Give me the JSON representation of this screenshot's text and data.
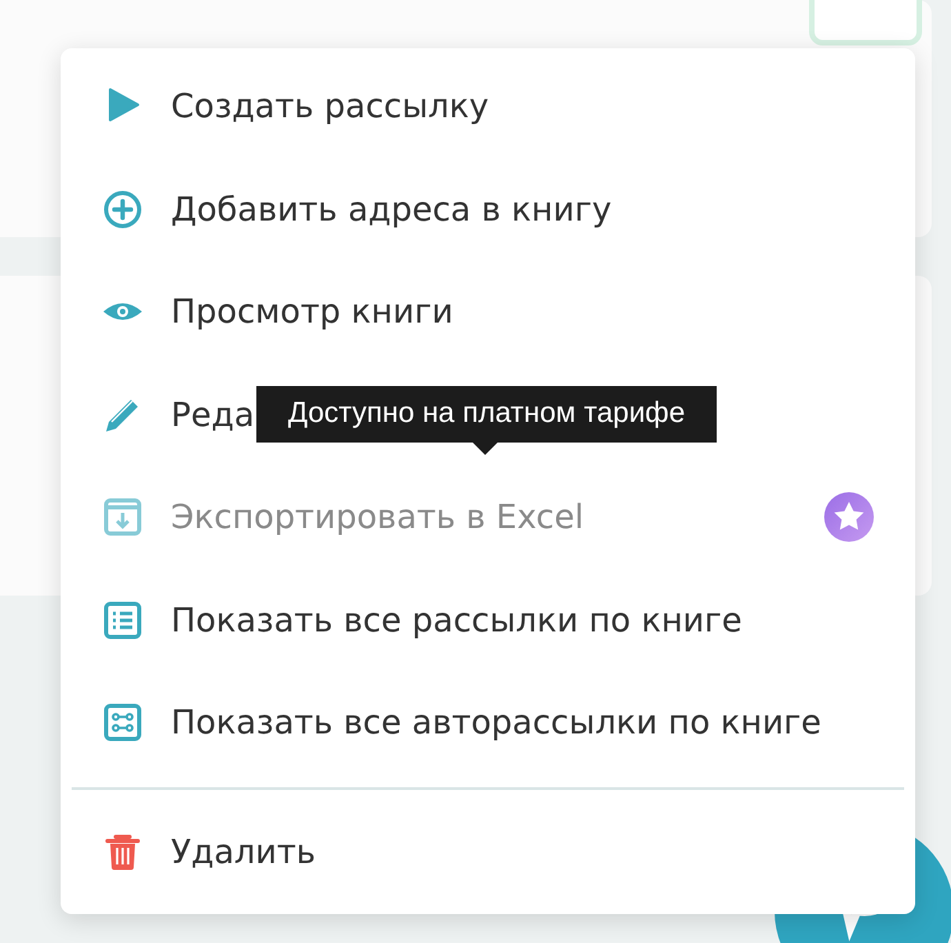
{
  "menu": {
    "items": [
      {
        "label": "Создать рассылку",
        "kind": "action",
        "disabled": false,
        "premium": false
      },
      {
        "label": "Добавить адреса в книгу",
        "kind": "action",
        "disabled": false,
        "premium": false
      },
      {
        "label": "Просмотр книги",
        "kind": "action",
        "disabled": false,
        "premium": false
      },
      {
        "label": "Реда",
        "kind": "action",
        "disabled": false,
        "premium": false
      },
      {
        "label": "Экспортировать в Excel",
        "kind": "action",
        "disabled": true,
        "premium": true
      },
      {
        "label": "Показать все рассылки по книге",
        "kind": "action",
        "disabled": false,
        "premium": false
      },
      {
        "label": "Показать все авторассылки по книге",
        "kind": "action",
        "disabled": false,
        "premium": false
      },
      {
        "label": "Удалить",
        "kind": "danger",
        "disabled": false,
        "premium": false
      }
    ]
  },
  "tooltip": {
    "text": "Доступно на платном тарифе"
  }
}
